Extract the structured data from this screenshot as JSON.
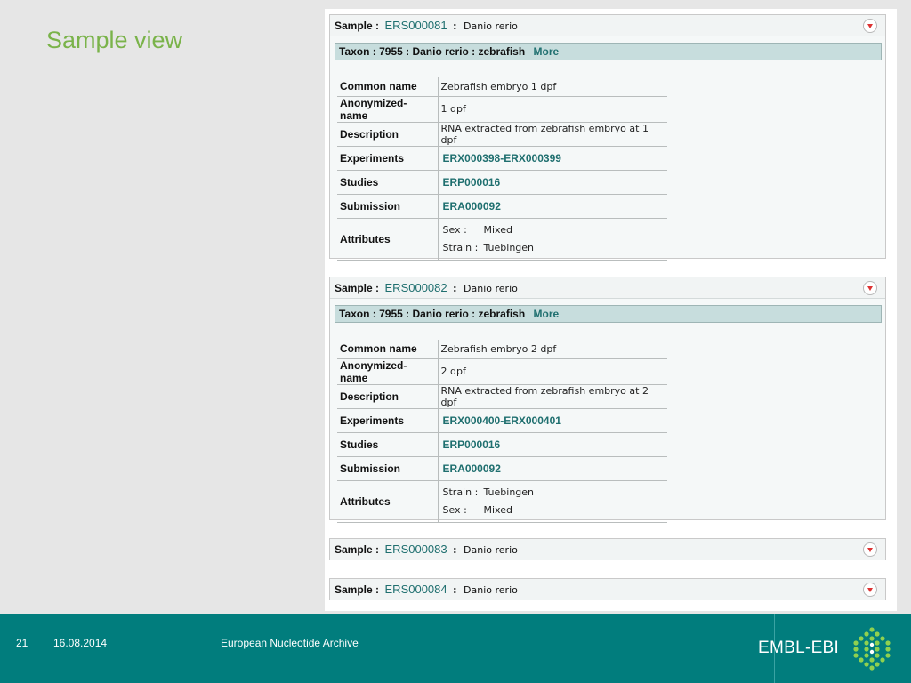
{
  "slide": {
    "title": "Sample view"
  },
  "labels": {
    "sample": "Sample :",
    "colon": ":",
    "more": "More",
    "common_name": "Common name",
    "anonymized_name": "Anonymized-name",
    "description": "Description",
    "experiments": "Experiments",
    "studies": "Studies",
    "submission": "Submission",
    "attributes": "Attributes"
  },
  "samples": [
    {
      "accession": "ERS000081",
      "organism": "Danio rerio",
      "taxon": "Taxon : 7955 : Danio rerio : zebrafish",
      "common_name": "Zebrafish embryo 1 dpf",
      "anonymized_name": "1 dpf",
      "description": "RNA extracted from zebrafish embryo at 1 dpf",
      "experiments": "ERX000398-ERX000399",
      "studies": "ERP000016",
      "submission": "ERA000092",
      "attributes": [
        {
          "key": "Sex :",
          "value": "Mixed"
        },
        {
          "key": "Strain :",
          "value": "Tuebingen"
        }
      ]
    },
    {
      "accession": "ERS000082",
      "organism": "Danio rerio",
      "taxon": "Taxon : 7955 : Danio rerio : zebrafish",
      "common_name": "Zebrafish embryo 2 dpf",
      "anonymized_name": "2 dpf",
      "description": "RNA extracted from zebrafish embryo at 2 dpf",
      "experiments": "ERX000400-ERX000401",
      "studies": "ERP000016",
      "submission": "ERA000092",
      "attributes": [
        {
          "key": "Strain :",
          "value": "Tuebingen"
        },
        {
          "key": "Sex :",
          "value": "Mixed"
        }
      ]
    },
    {
      "accession": "ERS000083",
      "organism": "Danio rerio"
    },
    {
      "accession": "ERS000084",
      "organism": "Danio rerio"
    }
  ],
  "footer": {
    "slide_number": "21",
    "date": "16.08.2014",
    "org": "European Nucleotide Archive",
    "brand": "EMBL-EBI"
  },
  "colors": {
    "title": "#7ab34a",
    "footer": "#017d7d",
    "link": "#1f6f6f",
    "taxon_bg": "#c7dddd"
  },
  "icons": {
    "toggle": "collapse-toggle-icon",
    "logo": "embl-ebi-logo-icon"
  }
}
